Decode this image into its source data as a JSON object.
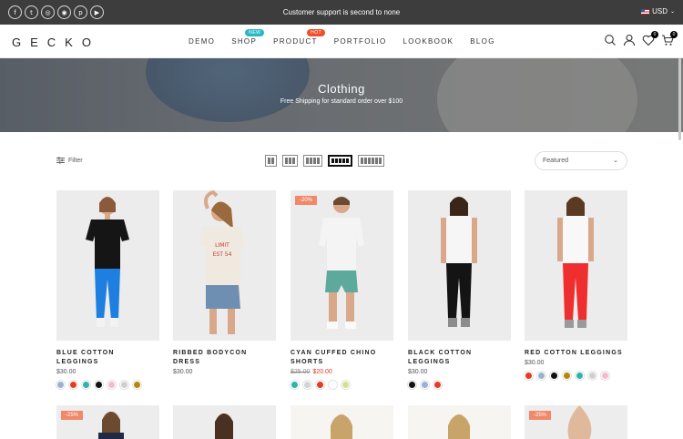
{
  "topbar": {
    "social_icons": [
      "facebook-icon",
      "twitter-icon",
      "instagram-icon",
      "dribbble-icon",
      "pinterest-icon",
      "youtube-icon"
    ],
    "social_glyphs": [
      "f",
      "t",
      "◎",
      "◉",
      "p",
      "▶"
    ],
    "message": "Customer support is second to none",
    "currency": "USD"
  },
  "header": {
    "logo": "GECKO",
    "nav": [
      {
        "label": "DEMO",
        "badge": ""
      },
      {
        "label": "SHOP",
        "badge": "NEW"
      },
      {
        "label": "PRODUCT",
        "badge": "HOT"
      },
      {
        "label": "PORTFOLIO",
        "badge": ""
      },
      {
        "label": "LOOKBOOK",
        "badge": ""
      },
      {
        "label": "BLOG",
        "badge": ""
      }
    ],
    "wishlist_count": "0",
    "cart_count": "0"
  },
  "hero": {
    "title": "Clothing",
    "subtitle": "Free Shipping for standard order over $100"
  },
  "toolbar": {
    "filter_label": "Filter",
    "sort_value": "Featured"
  },
  "products": [
    {
      "name": "BLUE COTTON LEGGINGS",
      "price": "$30.00",
      "old_price": "",
      "sale_price": "",
      "badge": "",
      "swatches": [
        "#9bb0d6",
        "#e63b24",
        "#2fb4ad",
        "#111111",
        "#f7b8d2",
        "#cfcfcf",
        "#b8860b"
      ]
    },
    {
      "name": "RIBBED BODYCON DRESS",
      "price": "$30.00",
      "old_price": "",
      "sale_price": "",
      "badge": "",
      "swatches": []
    },
    {
      "name": "CYAN CUFFED CHINO SHORTS",
      "price": "",
      "old_price": "$25.00",
      "sale_price": "$20.00",
      "badge": "-20%",
      "swatches": [
        "#2fb4ad",
        "#cfd3dc",
        "#e63b24",
        "#ffffff",
        "#d7e08a"
      ]
    },
    {
      "name": "BLACK COTTON LEGGINGS",
      "price": "$30.00",
      "old_price": "",
      "sale_price": "",
      "badge": "",
      "swatches": [
        "#111111",
        "#9bb0d6",
        "#e63b24"
      ]
    },
    {
      "name": "RED COTTON LEGGINGS",
      "price": "$30.00",
      "old_price": "",
      "sale_price": "",
      "badge": "",
      "swatches": [
        "#e63b24",
        "#9bb0d6",
        "#111111",
        "#b8860b",
        "#2fb4ad",
        "#cfcfcf",
        "#f7b8d2"
      ]
    }
  ],
  "row2_badges": [
    "-25%",
    "",
    "",
    "",
    "-25%"
  ]
}
